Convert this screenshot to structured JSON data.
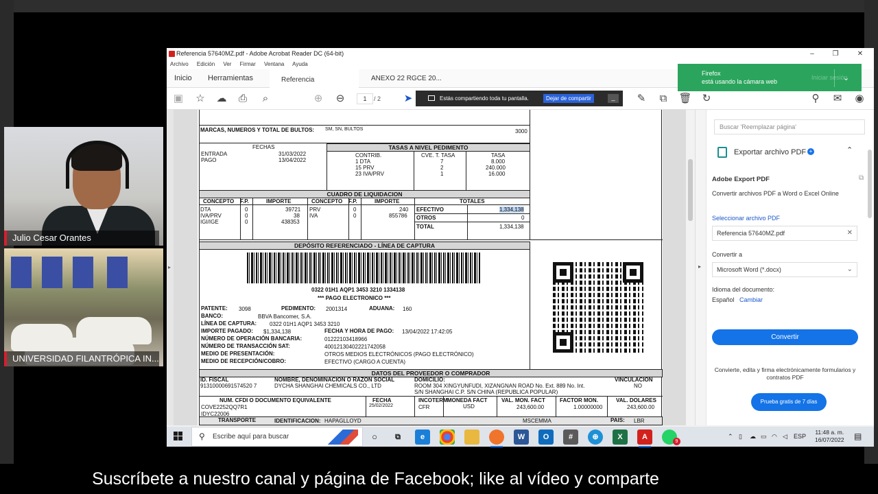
{
  "participants": [
    {
      "name": "Julio Cesar Orantes"
    },
    {
      "name": "UNIVERSIDAD FILANTRÓPICA IN..."
    }
  ],
  "window": {
    "title": "Referencia 57640MZ.pdf - Adobe Acrobat Reader DC (64-bit)",
    "menu": [
      "Archivo",
      "Edición",
      "Ver",
      "Firmar",
      "Ventana",
      "Ayuda"
    ],
    "tabs": [
      "Inicio",
      "Herramientas",
      "Referencia 57640MZ...",
      "ANEXO 22 RGCE 20..."
    ],
    "page_current": "1",
    "page_total": "/ 2",
    "share_text": "Estás compartiendo toda tu pantalla.",
    "share_button": "Dejar de compartir"
  },
  "firefox_notice": {
    "line1": "Firefox",
    "line2": "está usando la cámara web",
    "behind": "Iniciar sesión"
  },
  "document": {
    "marks_label": "MARCAS, NUMEROS Y TOTAL DE BULTOS:",
    "marks_value": "SM, SN, BULTOS",
    "marks_total": "3000",
    "fechas_header": "FECHAS",
    "entrada_label": "ENTRADA",
    "entrada_value": "31/03/2022",
    "pago_label": "PAGO",
    "pago_value": "13/04/2022",
    "tasas_header": "TASAS A NIVEL PEDIMENTO",
    "tasas_cols": [
      "CONTRIB.",
      "CVE. T. TASA",
      "TASA"
    ],
    "tasas_rows": [
      [
        "1 DTA",
        "7",
        "8.000"
      ],
      [
        "15 PRV",
        "2",
        "240.000"
      ],
      [
        "23 IVA/PRV",
        "1",
        "16.000"
      ]
    ],
    "liquidacion_header": "CUADRO DE LIQUIDACION",
    "liq_cols": [
      "CONCEPTO",
      "F.P.",
      "IMPORTE",
      "CONCEPTO",
      "F.P.",
      "IMPORTE",
      "TOTALES"
    ],
    "liq_rows_left": [
      [
        "DTA",
        "0",
        "39721"
      ],
      [
        "IVA/PRV",
        "0",
        "38"
      ],
      [
        "IGI/IGE",
        "0",
        "438353"
      ]
    ],
    "liq_rows_mid": [
      [
        "PRV",
        "0",
        "240"
      ],
      [
        "IVA",
        "0",
        "855786"
      ]
    ],
    "totales": [
      [
        "EFECTIVO",
        "1,334,138"
      ],
      [
        "OTROS",
        "0"
      ],
      [
        "TOTAL",
        "1,334,138"
      ]
    ],
    "deposito_header": "DEPÓSITO REFERENCIADO - LÍNEA DE CAPTURA",
    "barcode_text": "0322 01H1 AQP1 3453 3210      1334138",
    "pago_electronico": "***  PAGO ELECTRONICO  ***",
    "patente_label": "PATENTE:",
    "patente_value": "3098",
    "pedimento_label": "PEDIMENTO:",
    "pedimento_value": "2001314",
    "aduana_label": "ADUANA:",
    "aduana_value": "160",
    "banco_label": "BANCO:",
    "banco_value": "BBVA Bancomer, S.A.",
    "linea_label": "LÍNEA DE CAPTURA:",
    "linea_value": "0322 01H1 AQP1 3453 3210",
    "importe_label": "IMPORTE PAGADO:",
    "importe_value": "$1,334,138",
    "fecha_pago_label": "FECHA Y HORA DE PAGO:",
    "fecha_pago_value": "13/04/2022 17:42:05",
    "operacion_label": "NÚMERO DE OPERACIÓN BANCARIA:",
    "operacion_value": "01222103418966",
    "transaccion_label": "NÚMERO DE TRANSACCIÓN SAT:",
    "transaccion_value": "40012130402221742058",
    "presentacion_label": "MEDIO DE PRESENTACIÓN:",
    "presentacion_value": "OTROS MEDIOS ELECTRÓNICOS (PAGO ELECTRÓNICO)",
    "recepcion_label": "MEDIO DE RECEPCIÓN/COBRO:",
    "recepcion_value": "EFECTIVO (CARGO A CUENTA)",
    "proveedor_header": "DATOS DEL PROVEEDOR O COMPRADOR",
    "id_fiscal_label": "ID. FISCAL",
    "id_fiscal_value": "91310000691574520 7",
    "nombre_label": "NOMBRE, DENOMINACION O RAZON SOCIAL",
    "nombre_value": "DYCHA SHANGHAI CHEMICALS CO., LTD",
    "domicilio_label": "DOMICILIO:",
    "domicilio_value1": "ROOM 304 XINGYUNFUDI, XIZANGNAN ROAD No. Ext. 889 No. Int.",
    "domicilio_value2": "S/N SHANGHAI C.P. S/N CHINA (REPUBLICA POPULAR)",
    "vinculacion_label": "VINCULACION",
    "vinculacion_value": "NO",
    "cfdi_cols": [
      "NUM. CFDI O DOCUMENTO EQUIVALENTE",
      "FECHA",
      "INCOTERM",
      "MONEDA FACT",
      "VAL. MON. FACT",
      "FACTOR MON.",
      "VAL. DOLARES"
    ],
    "cfdi_row": [
      "COVE2252QQ7R1",
      "25/02/2022",
      "CFR",
      "USD",
      "243,600.00",
      "1.00000000",
      "243,600.00"
    ],
    "idyc": "IDYC22006",
    "transporte_label": "TRANSPORTE",
    "identificacion_label": "IDENTIFICACION:",
    "identificacion_value": "HAPAGLLOYD",
    "mscemma": "MSCEMMA",
    "pais_label": "PAIS:",
    "pais_value": "LBR"
  },
  "right_panel": {
    "search_placeholder": "Buscar 'Reemplazar página'",
    "export_title": "Exportar archivo PDF",
    "service_title": "Adobe Export PDF",
    "service_desc": "Convertir archivos PDF a Word o Excel Online",
    "select_link": "Seleccionar archivo PDF",
    "selected_file": "Referencia 57640MZ.pdf",
    "convert_to_label": "Convertir a",
    "convert_to_value": "Microsoft Word (*.docx)",
    "language_label": "Idioma del documento:",
    "language_value": "Español",
    "language_change": "Cambiar",
    "convert_button": "Convertir",
    "promo": "Convierte, edita y firma electrónicamente formularios y contratos PDF",
    "trial_button": "Prueba gratis de 7 días"
  },
  "taskbar": {
    "search_placeholder": "Escribe aquí para buscar",
    "lang": "ESP",
    "time": "11:48 a. m.",
    "date": "16/07/2022",
    "notif_count": "9"
  },
  "subtitle": "Suscríbete a nuestro canal y página de Facebook; like al vídeo y comparte",
  "colors": {
    "accent": "#1473e6",
    "firefox_banner": "#2ba55d",
    "acrobat_red": "#d2211d",
    "name_bar": "#d81e2d"
  }
}
